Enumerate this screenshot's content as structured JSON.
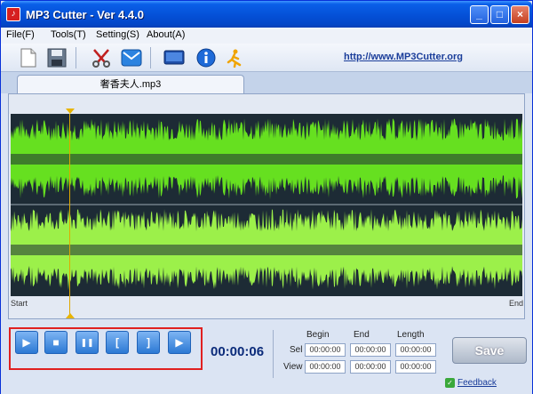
{
  "window": {
    "title": "MP3 Cutter - Ver 4.4.0",
    "controls": {
      "minimize": "_",
      "maximize": "□",
      "close": "×"
    }
  },
  "menu": [
    {
      "label": "File(F)"
    },
    {
      "label": "Tools(T)"
    },
    {
      "label": "Setting(S)"
    },
    {
      "label": "About(A)"
    }
  ],
  "toolbar": {
    "icons": [
      "new-file-icon",
      "save-icon",
      "scissors-icon",
      "email-icon",
      "screen-icon",
      "info-icon",
      "run-icon"
    ],
    "url": "http://www.MP3Cutter.org"
  },
  "file_tab": {
    "label": "奢香夫人.mp3"
  },
  "waveform": {
    "start_label": "Start",
    "end_label": "End",
    "colors": {
      "background": "#1d2b35",
      "wave": "#66e020",
      "wave_light": "#9cf04a"
    }
  },
  "transport": {
    "buttons": [
      {
        "name": "play",
        "glyph": "▶"
      },
      {
        "name": "stop",
        "glyph": "■"
      },
      {
        "name": "pause",
        "glyph": "❚❚"
      },
      {
        "name": "mark-begin",
        "glyph": "["
      },
      {
        "name": "mark-end",
        "glyph": "]"
      },
      {
        "name": "play-selection",
        "glyph": "▶"
      }
    ],
    "time": "00:00:06"
  },
  "selection": {
    "headers": {
      "begin": "Begin",
      "end": "End",
      "length": "Length"
    },
    "rows": [
      {
        "label": "Sel",
        "begin": "00:00:00",
        "end": "00:00:00",
        "length": "00:00:00"
      },
      {
        "label": "View",
        "begin": "00:00:00",
        "end": "00:00:00",
        "length": "00:00:00"
      }
    ]
  },
  "save_label": "Save",
  "feedback_label": "Feedback"
}
